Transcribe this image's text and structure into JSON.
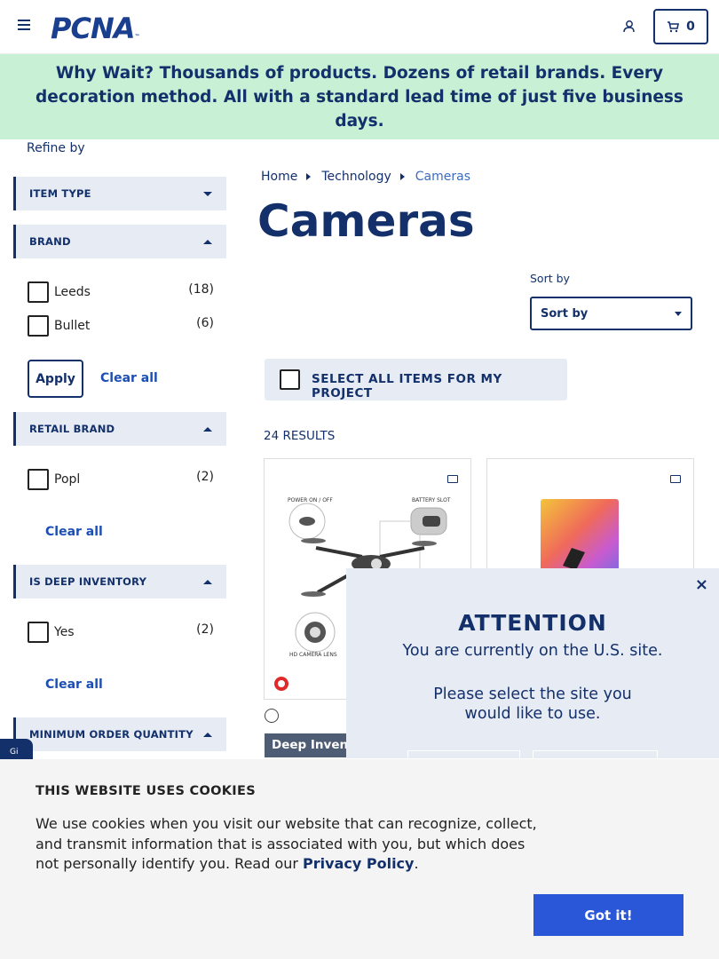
{
  "header": {
    "logo_text": "PCNA",
    "logo_tm": "™",
    "cart_count": "0"
  },
  "banner": {
    "lead": "Why Wait?",
    "text": " Thousands of products. Dozens of retail brands. Every decoration method. All with a standard lead time of just five business days."
  },
  "sidebar": {
    "refine_label": "Refine by",
    "facets": {
      "item_type": "ITEM TYPE",
      "brand": "BRAND",
      "retail_brand": "RETAIL BRAND",
      "deep_inventory": "IS DEEP INVENTORY",
      "min_order": "MINIMUM ORDER QUANTITY"
    },
    "brand_options": [
      {
        "label": "Leeds",
        "count": "(18)"
      },
      {
        "label": "Bullet",
        "count": "(6)"
      }
    ],
    "retail_brand_options": [
      {
        "label": "Popl",
        "count": "(2)"
      }
    ],
    "deep_inventory_options": [
      {
        "label": "Yes",
        "count": "(2)"
      }
    ],
    "apply_label": "Apply",
    "clear_all_label": "Clear all"
  },
  "breadcrumb": {
    "home": "Home",
    "technology": "Technology",
    "current": "Cameras"
  },
  "main": {
    "title": "Cameras",
    "sort_label": "Sort by",
    "sort_value": "Sort by",
    "select_all_label": "SELECT ALL ITEMS FOR MY PROJECT",
    "results_count": "24 RESULTS",
    "deep_inventory_badge": "Deep Inventory",
    "drone_labels": {
      "power": "POWER ON / OFF",
      "battery": "BATTERY SLOT",
      "camera": "HD CAMERA LENS"
    }
  },
  "attention": {
    "close_label": "×",
    "title": "ATTENTION",
    "line1": "You are currently on the U.S. site.",
    "line2": "Please select the site you",
    "line3": "would like to use."
  },
  "gi_tab": "Gi",
  "cookie": {
    "title": "THIS WEBSITE USES COOKIES",
    "text": "We use cookies when you visit our website that can recognize, collect, and transmit information that is associated with you, but which does not personally identify you. Read our ",
    "link": "Privacy Policy",
    "after_link": ".",
    "button": "Got it!"
  },
  "colors": {
    "navy": "#13306b",
    "banner_bg": "#c8f0d4",
    "facet_bg": "#e6ebf4",
    "link_blue": "#1b4fb5",
    "button_blue": "#2a57d8",
    "badge_gray": "#4e5d73"
  }
}
